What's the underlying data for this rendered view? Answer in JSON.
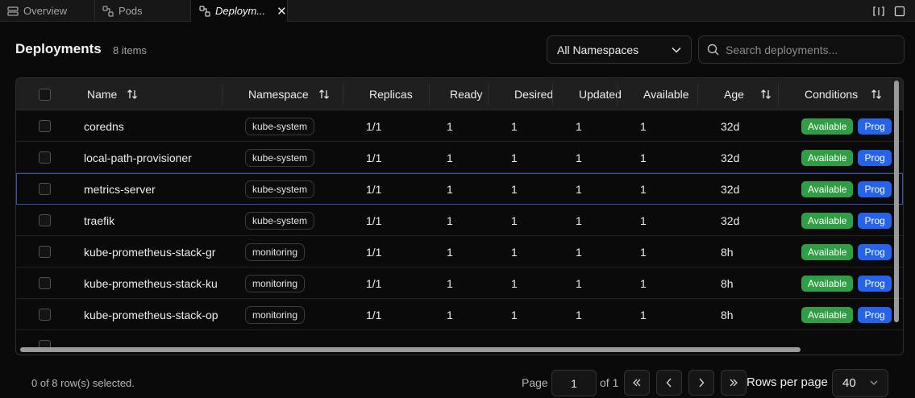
{
  "tabs": [
    {
      "label": "Overview",
      "icon": "layers-icon"
    },
    {
      "label": "Pods",
      "icon": "nodes-icon"
    },
    {
      "label": "Deploym...",
      "icon": "nodes-icon",
      "active": true
    }
  ],
  "header": {
    "title": "Deployments",
    "count": "8 items"
  },
  "filters": {
    "namespace_selected": "All Namespaces",
    "search_placeholder": "Search deployments..."
  },
  "table": {
    "columns": [
      "Name",
      "Namespace",
      "Replicas",
      "Ready",
      "Desired",
      "Updated",
      "Available",
      "Age",
      "Conditions"
    ],
    "rows": [
      {
        "name": "coredns",
        "namespace": "kube-system",
        "replicas": "1/1",
        "ready": "1",
        "desired": "1",
        "updated": "1",
        "available": "1",
        "age": "32d",
        "cond1": "Available",
        "cond2": "Prog"
      },
      {
        "name": "local-path-provisioner",
        "namespace": "kube-system",
        "replicas": "1/1",
        "ready": "1",
        "desired": "1",
        "updated": "1",
        "available": "1",
        "age": "32d",
        "cond1": "Available",
        "cond2": "Prog"
      },
      {
        "name": "metrics-server",
        "namespace": "kube-system",
        "replicas": "1/1",
        "ready": "1",
        "desired": "1",
        "updated": "1",
        "available": "1",
        "age": "32d",
        "cond1": "Available",
        "cond2": "Prog"
      },
      {
        "name": "traefik",
        "namespace": "kube-system",
        "replicas": "1/1",
        "ready": "1",
        "desired": "1",
        "updated": "1",
        "available": "1",
        "age": "32d",
        "cond1": "Available",
        "cond2": "Prog"
      },
      {
        "name": "kube-prometheus-stack-gr",
        "namespace": "monitoring",
        "replicas": "1/1",
        "ready": "1",
        "desired": "1",
        "updated": "1",
        "available": "1",
        "age": "8h",
        "cond1": "Available",
        "cond2": "Prog"
      },
      {
        "name": "kube-prometheus-stack-ku",
        "namespace": "monitoring",
        "replicas": "1/1",
        "ready": "1",
        "desired": "1",
        "updated": "1",
        "available": "1",
        "age": "8h",
        "cond1": "Available",
        "cond2": "Prog"
      },
      {
        "name": "kube-prometheus-stack-op",
        "namespace": "monitoring",
        "replicas": "1/1",
        "ready": "1",
        "desired": "1",
        "updated": "1",
        "available": "1",
        "age": "8h",
        "cond1": "Available",
        "cond2": "Prog"
      }
    ]
  },
  "footer": {
    "selection": "0 of 8 row(s) selected.",
    "page_label": "Page",
    "page_value": "1",
    "page_of": "of 1",
    "rows_per_page_label": "Rows per page",
    "rows_per_page_value": "40"
  },
  "colors": {
    "available": "#2f9e44",
    "progressing": "#2563eb",
    "selected_outline": "#3b4fb8"
  }
}
